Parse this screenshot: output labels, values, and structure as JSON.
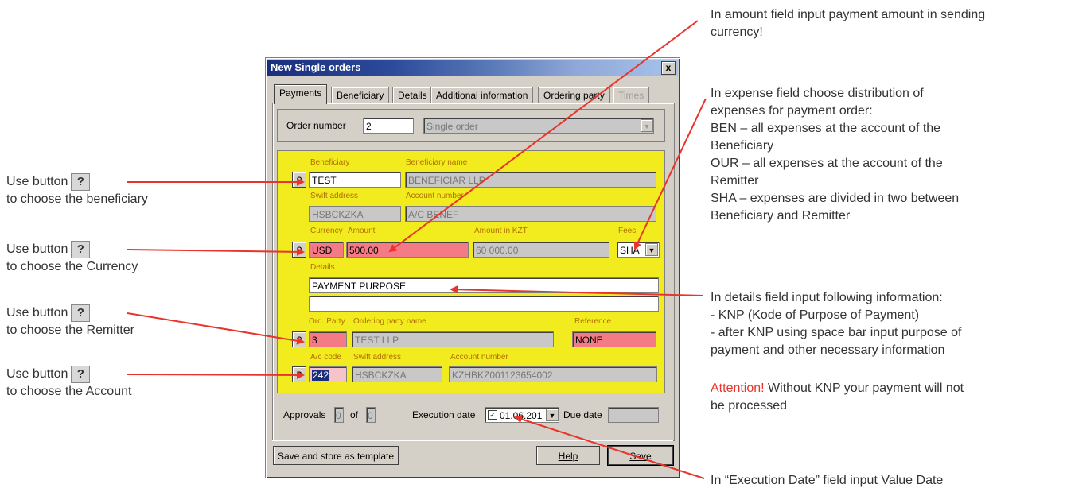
{
  "dialog": {
    "title": "New  Single orders",
    "close_label": "x",
    "tabs": [
      {
        "label": "Payments"
      },
      {
        "label": "Beneficiary"
      },
      {
        "label": "Details"
      },
      {
        "label": "Additional information"
      },
      {
        "label": "Ordering party"
      },
      {
        "label": "Times"
      }
    ],
    "order_number_label": "Order number",
    "order_number_value": "2",
    "order_type_value": "Single order",
    "form": {
      "question": "?",
      "beneficiary_label": "Beneficiary",
      "beneficiary_value": "TEST",
      "beneficiary_name_label": "Beneficiary name",
      "beneficiary_name_value": "BENEFICIAR LLP",
      "swift_label": "Swift address",
      "swift_value": "HSBCKZKA",
      "account_number_label": "Account number",
      "account_number_value": "A/C BENEF",
      "currency_label": "Currency",
      "currency_value": "USD",
      "amount_label": "Amount",
      "amount_value": "500.00",
      "amount_kzt_label": "Amount in KZT",
      "amount_kzt_value": "60 000.00",
      "fees_label": "Fees",
      "fees_value": "SHA",
      "details_label": "Details",
      "details_line1": "PAYMENT PURPOSE",
      "details_line2": "",
      "ord_party_label": "Ord. Party",
      "ord_party_value": "3",
      "ordering_party_name_label": "Ordering party name",
      "ordering_party_name_value": "TEST LLP",
      "reference_label": "Reference",
      "reference_value": "NONE",
      "ac_code_label": "A/c code",
      "ac_code_value": "242",
      "swift2_label": "Swift address",
      "swift2_value": "HSBCKZKA",
      "account_number2_label": "Account number",
      "account_number2_value": "KZHBKZ001123654002"
    },
    "approvals_label": "Approvals",
    "approvals_value": "0",
    "of_label": "of",
    "of_value": "0",
    "execution_date_label": "Execution date",
    "execution_date_value": "01.06.201",
    "due_date_label": "Due date",
    "due_date_value": "",
    "save_template_label": "Save and store as template",
    "help_label": "Help",
    "save_label": "Save"
  },
  "annotations": {
    "left": [
      {
        "line1": "Use button",
        "btn": "?",
        "line2": "to choose the beneficiary"
      },
      {
        "line1": "Use button",
        "btn": "?",
        "line2": "to choose the Currency"
      },
      {
        "line1": "Use button",
        "btn": "?",
        "line2": "to choose the Remitter"
      },
      {
        "line1": "Use button",
        "btn": "?",
        "line2": "to choose the Account"
      }
    ],
    "amount": "In amount field input payment amount in sending currency!",
    "expense_lines": [
      "In expense field choose distribution of",
      "expenses for payment order:",
      "BEN – all expenses at the account of the",
      "Beneficiary",
      "OUR – all expenses at the account of the",
      "Remitter",
      "SHA – expenses are divided in two between",
      "Beneficiary and Remitter"
    ],
    "details_lines": [
      "In details field input following information:",
      "- KNP (Kode of Purpose of Payment)",
      "- after KNP using space bar input purpose of",
      "payment and other necessary information"
    ],
    "attention_word": "Attention!",
    "attention_rest": "  Without KNP your payment will not",
    "attention_line2": "be processed",
    "execution": "In “Execution Date” field input Value Date"
  },
  "colors": {
    "arrow": "#e8342a",
    "highlight": "#f2ec1e",
    "pink_field": "#f47a86"
  }
}
